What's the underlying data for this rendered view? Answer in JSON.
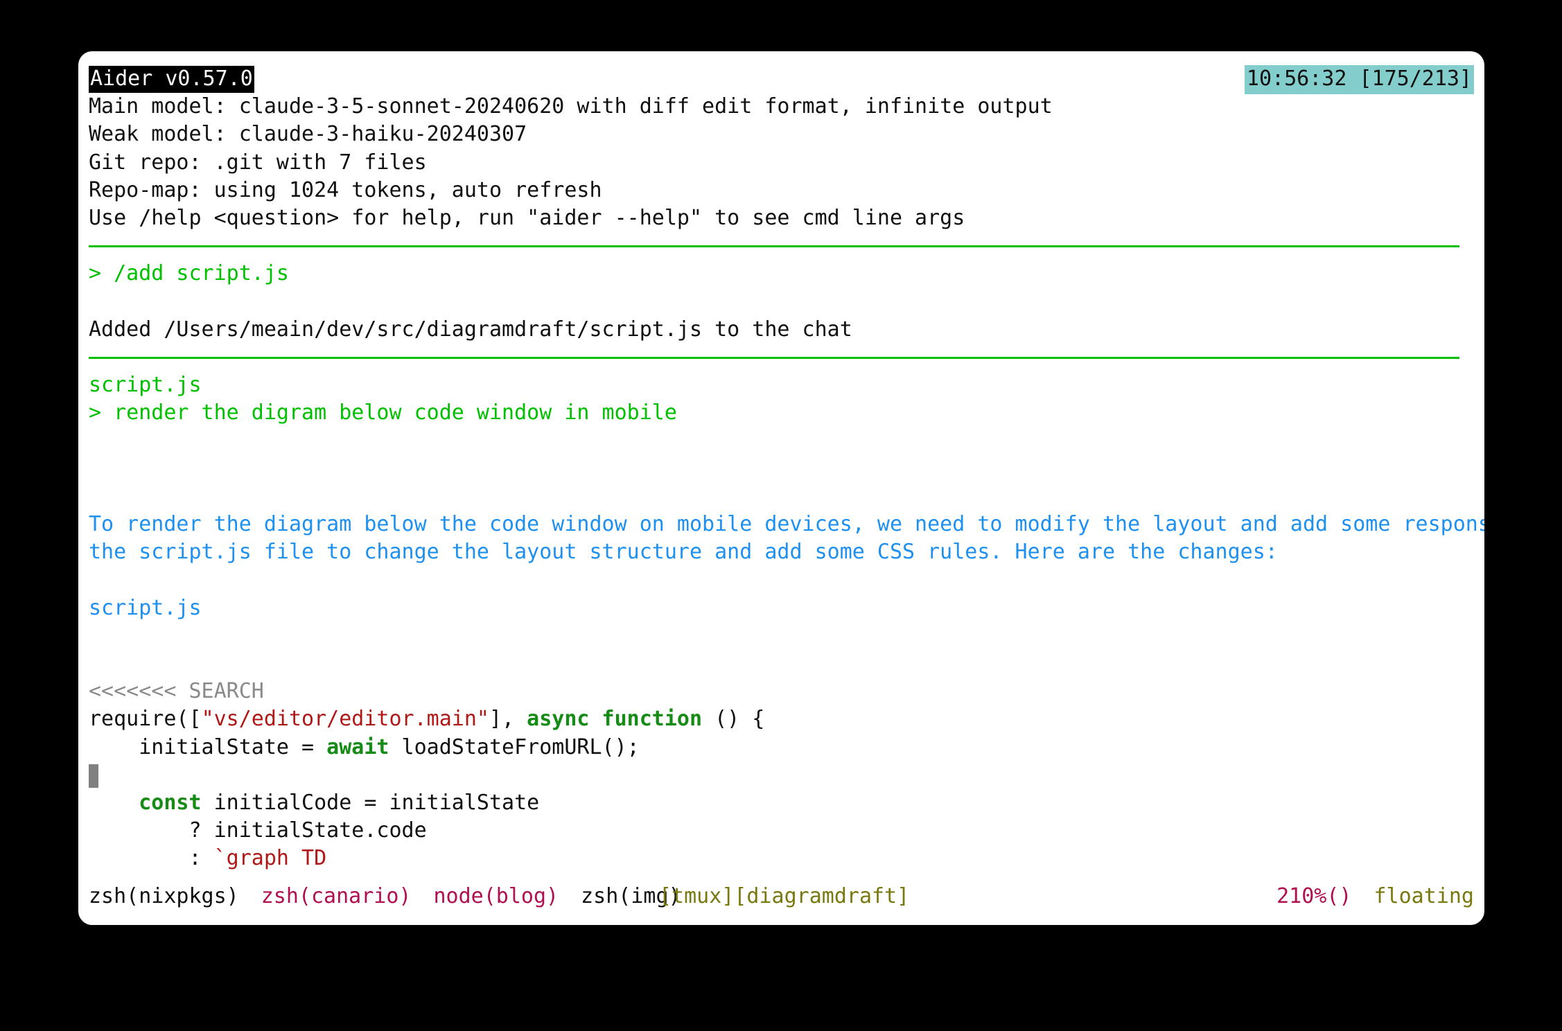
{
  "window": {
    "app": "terminal",
    "background_color": "#ffffff",
    "page_background_color": "#000000"
  },
  "header": {
    "title": "Aider v0.57.0",
    "clock": "10:56:32 [175/213]",
    "clock_bg": "#84cdcd",
    "lines": [
      "Main model: claude-3-5-sonnet-20240620 with diff edit format, infinite output",
      "Weak model: claude-3-haiku-20240307",
      "Git repo: .git with 7 files",
      "Repo-map: using 1024 tokens, auto refresh",
      "Use /help <question> for help, run \"aider --help\" to see cmd line args"
    ]
  },
  "transcript": {
    "command_prompt": "> /add script.js",
    "added_message": "Added /Users/meain/dev/src/diagramdraft/script.js to the chat",
    "context_file": "script.js",
    "user_prompt": "> render the digram below code window in mobile",
    "assistant_paragraph_line1": "To render the diagram below the code window on mobile devices, we need to modify the layout and add some responsive CSS. We'll update",
    "assistant_paragraph_line2": "the script.js file to change the layout structure and add some CSS rules. Here are the changes:",
    "assistant_file_label": "script.js"
  },
  "code_block": {
    "search_marker": "<<<<<<< SEARCH",
    "line_require_pre": "require([",
    "line_require_string": "\"vs/editor/editor.main\"",
    "line_require_mid": "], ",
    "line_require_kw": "async function",
    "line_require_post": " () {",
    "line_initial_pre": "    initialState = ",
    "line_initial_kw": "await",
    "line_initial_post": " loadStateFromURL();",
    "line_const_kw": "    const",
    "line_const_post": " initialCode = initialState",
    "line_ternary_true": "        ? initialState.code",
    "line_ternary_false_pre": "        : ",
    "line_ternary_false_str": "`graph TD"
  },
  "status_bar": {
    "windows": [
      {
        "label": "zsh(nixpkgs)",
        "color": "#101010"
      },
      {
        "label": "zsh(canario)",
        "color": "#b01050"
      },
      {
        "label": "node(blog)",
        "color": "#b01050"
      },
      {
        "label": "zsh(img)",
        "color": "#101010"
      }
    ],
    "session": "[tmux][diagramdraft]",
    "zoom": "210%()",
    "mode": "floating"
  }
}
